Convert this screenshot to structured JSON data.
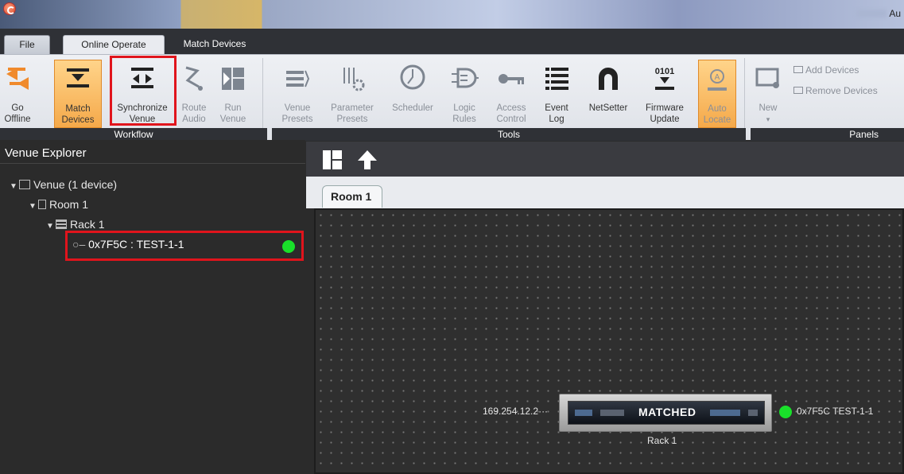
{
  "window": {
    "title": "Au"
  },
  "tabs": {
    "file": "File",
    "online_operate": "Online Operate",
    "match_devices": "Match Devices"
  },
  "ribbon": {
    "workflow": {
      "group_label": "Workflow",
      "go_offline": [
        "Go",
        "Offline"
      ],
      "match_devices": [
        "Match",
        "Devices"
      ],
      "synchronize_venue": [
        "Synchronize",
        "Venue"
      ],
      "route_audio": [
        "Route",
        "Audio"
      ],
      "run_venue": [
        "Run",
        "Venue"
      ]
    },
    "tools": {
      "group_label": "Tools",
      "venue_presets": [
        "Venue",
        "Presets"
      ],
      "parameter_presets": [
        "Parameter",
        "Presets"
      ],
      "scheduler": [
        "Scheduler",
        ""
      ],
      "logic_rules": [
        "Logic",
        "Rules"
      ],
      "access_control": [
        "Access",
        "Control"
      ],
      "event_log": [
        "Event",
        "Log"
      ],
      "netsetter": [
        "NetSetter",
        ""
      ],
      "firmware_update": [
        "Firmware",
        "Update"
      ],
      "auto_locate": [
        "Auto",
        "Locate"
      ],
      "firmware_icon_text": "0101"
    },
    "panels": {
      "group_label": "Panels",
      "new": "New",
      "add_devices": "Add Devices",
      "remove_devices": "Remove Devices"
    }
  },
  "explorer": {
    "title": "Venue Explorer",
    "venue": "Venue (1 device)",
    "room": "Room 1",
    "rack": "Rack 1",
    "device": "0x7F5C : TEST-1-1"
  },
  "canvas": {
    "tab": "Room 1",
    "ip": "169.254.12.2···",
    "status": "MATCHED",
    "rack_label": "Rack 1",
    "device_label": "0x7F5C  TEST-1-1"
  },
  "colors": {
    "active_orange": "#f5a94a",
    "highlight_red": "#e0141c",
    "online_green": "#19e02a"
  }
}
